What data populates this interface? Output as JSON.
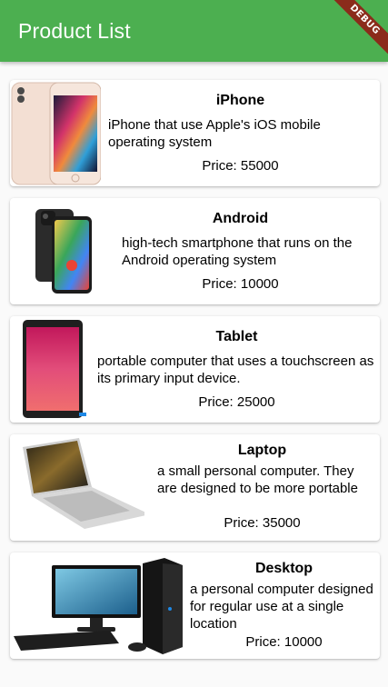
{
  "appbar": {
    "title": "Product List",
    "debug_label": "DEBUG"
  },
  "colors": {
    "appbar": "#4caf50",
    "ribbon": "#8b2b1b",
    "card": "#ffffff",
    "background": "#fafafa"
  },
  "products": [
    {
      "name": "iPhone",
      "description": "iPhone that use Apple's iOS mobile operating system",
      "price": "Price: 55000",
      "image": "iphone-image"
    },
    {
      "name": "Android",
      "description": "high-tech smartphone that runs on the Android operating system",
      "price": "Price: 10000",
      "image": "android-phone-image"
    },
    {
      "name": "Tablet",
      "description": "portable computer that uses a touchscreen as its primary input device.",
      "price": "Price: 25000",
      "image": "tablet-image"
    },
    {
      "name": "Laptop",
      "description": "a small personal computer. They are designed to be more portable",
      "price": "Price: 35000",
      "image": "laptop-image"
    },
    {
      "name": "Desktop",
      "description": "a personal computer designed for regular use at a single location",
      "price": "Price: 10000",
      "image": "desktop-image"
    }
  ]
}
